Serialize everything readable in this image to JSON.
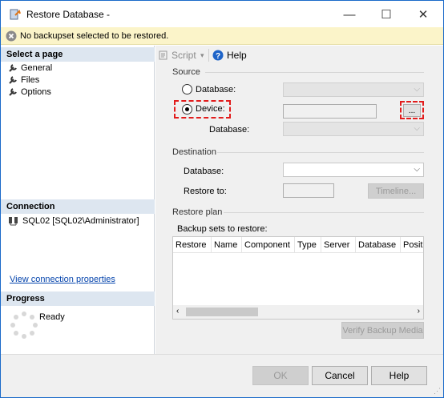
{
  "window": {
    "title": "Restore Database -",
    "minimize_glyph": "—",
    "maximize_glyph": "☐",
    "close_glyph": "✕"
  },
  "banner": {
    "message": "No backupset selected to be restored."
  },
  "left": {
    "select_page_header": "Select a page",
    "pages": [
      {
        "label": "General"
      },
      {
        "label": "Files"
      },
      {
        "label": "Options"
      }
    ],
    "connection_header": "Connection",
    "connection_text": "SQL02 [SQL02\\Administrator]",
    "view_connection_link": "View connection properties",
    "progress_header": "Progress",
    "progress_status": "Ready"
  },
  "toolbar": {
    "script_label": "Script",
    "help_label": "Help"
  },
  "source": {
    "group_label": "Source",
    "database_radio_label": "Database:",
    "device_radio_label": "Device:",
    "device_path_value": "",
    "browse_label": "...",
    "database_label": "Database:"
  },
  "destination": {
    "group_label": "Destination",
    "database_label": "Database:",
    "database_value": "",
    "restore_to_label": "Restore to:",
    "restore_to_value": "",
    "timeline_label": "Timeline..."
  },
  "restore_plan": {
    "group_label": "Restore plan",
    "backup_sets_label": "Backup sets to restore:",
    "columns": [
      "Restore",
      "Name",
      "Component",
      "Type",
      "Server",
      "Database",
      "Posit"
    ],
    "verify_label": "Verify Backup Media"
  },
  "footer": {
    "ok_label": "OK",
    "cancel_label": "Cancel",
    "help_label": "Help"
  },
  "colors": {
    "highlight": "#e21c1c",
    "link": "#0645ad",
    "banner_bg": "#fbf4c9",
    "section_header_bg": "#dde6f0"
  }
}
